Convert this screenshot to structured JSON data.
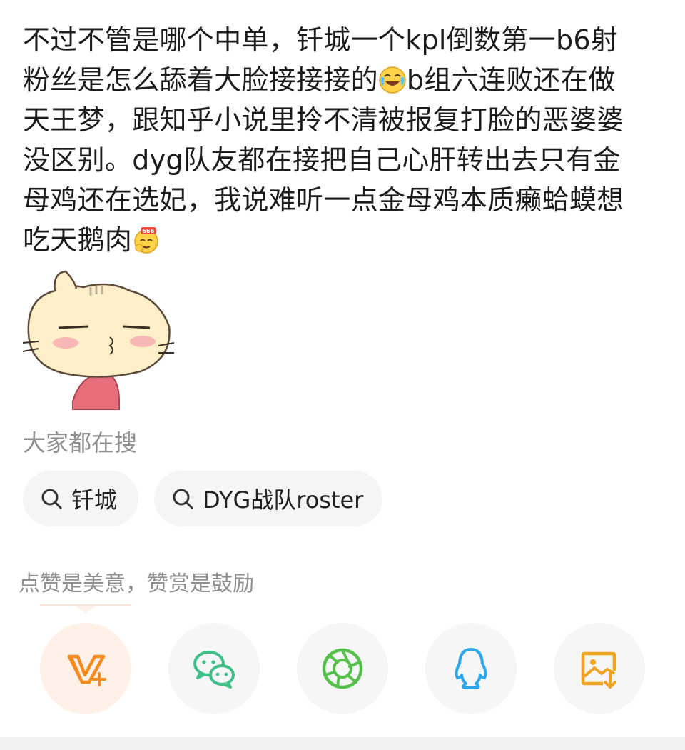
{
  "post": {
    "lines": [
      "不过不管是哪个中单，钎城一个kpl倒数第一b6射",
      "粉丝是怎么舔着大脸接接接的",
      "b组六连败还在做",
      "天王梦，跟知乎小说里拎不清被报复打脸的恶婆婆",
      "没区别。dyg队友都在接把自己心肝转出去只有金",
      "母鸡还在选妃，我说难听一点金母鸡本质癞蛤蟆想",
      "吃天鹅肉"
    ],
    "emoji_laugh_cry": "laugh-cry-emoji",
    "emoji_666": "666-emoji",
    "sticker": "cat-sticker"
  },
  "search": {
    "title": "大家都在搜",
    "chips": [
      {
        "label": "钎城",
        "icon": "search-icon"
      },
      {
        "label": "DYG战队roster",
        "icon": "search-icon"
      }
    ]
  },
  "reward": {
    "text": "点赞是美意，赞赏是鼓励"
  },
  "share": {
    "buttons": [
      {
        "name": "v-plus",
        "icon": "v-plus-icon",
        "color": "#f58a1f"
      },
      {
        "name": "wechat",
        "icon": "wechat-icon",
        "color": "#3fc088"
      },
      {
        "name": "moments",
        "icon": "moments-icon",
        "color": "#57c04c"
      },
      {
        "name": "qq",
        "icon": "qq-icon",
        "color": "#2ea7e8"
      },
      {
        "name": "save-image",
        "icon": "save-image-icon",
        "color": "#f2a322"
      }
    ]
  }
}
